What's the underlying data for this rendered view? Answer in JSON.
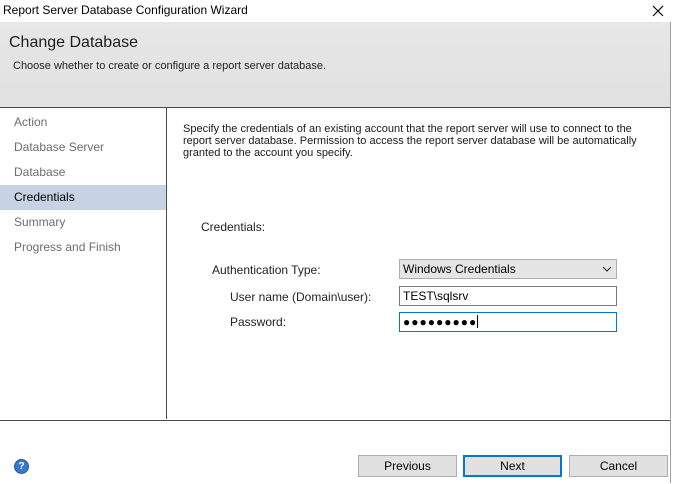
{
  "window": {
    "title": "Report Server Database Configuration Wizard"
  },
  "header": {
    "title": "Change Database",
    "subtitle": "Choose whether to create or configure a report server database."
  },
  "sidebar": {
    "items": [
      {
        "label": "Action"
      },
      {
        "label": "Database Server"
      },
      {
        "label": "Database"
      },
      {
        "label": "Credentials"
      },
      {
        "label": "Summary"
      },
      {
        "label": "Progress and Finish"
      }
    ]
  },
  "main": {
    "description": "Specify the credentials of an existing account that the report server will use to connect to the report server database.  Permission to access the report server database will be automatically granted to the account you specify.",
    "credentials_heading": "Credentials:",
    "auth_type_label": "Authentication Type:",
    "auth_type_value": "Windows Credentials",
    "username_label": "User name (Domain\\user):",
    "username_value": "TEST\\sqlsrv",
    "password_label": "Password:",
    "password_value": "●●●●●●●●●"
  },
  "footer": {
    "previous_label": "Previous",
    "next_label": "Next",
    "cancel_label": "Cancel"
  },
  "colors": {
    "selected_nav_bg": "#c7d3e3",
    "focus_border": "#0078d7",
    "header_bg": "#e5e5e5"
  },
  "icons": [
    "close-icon",
    "chevron-down-icon",
    "help-icon"
  ]
}
